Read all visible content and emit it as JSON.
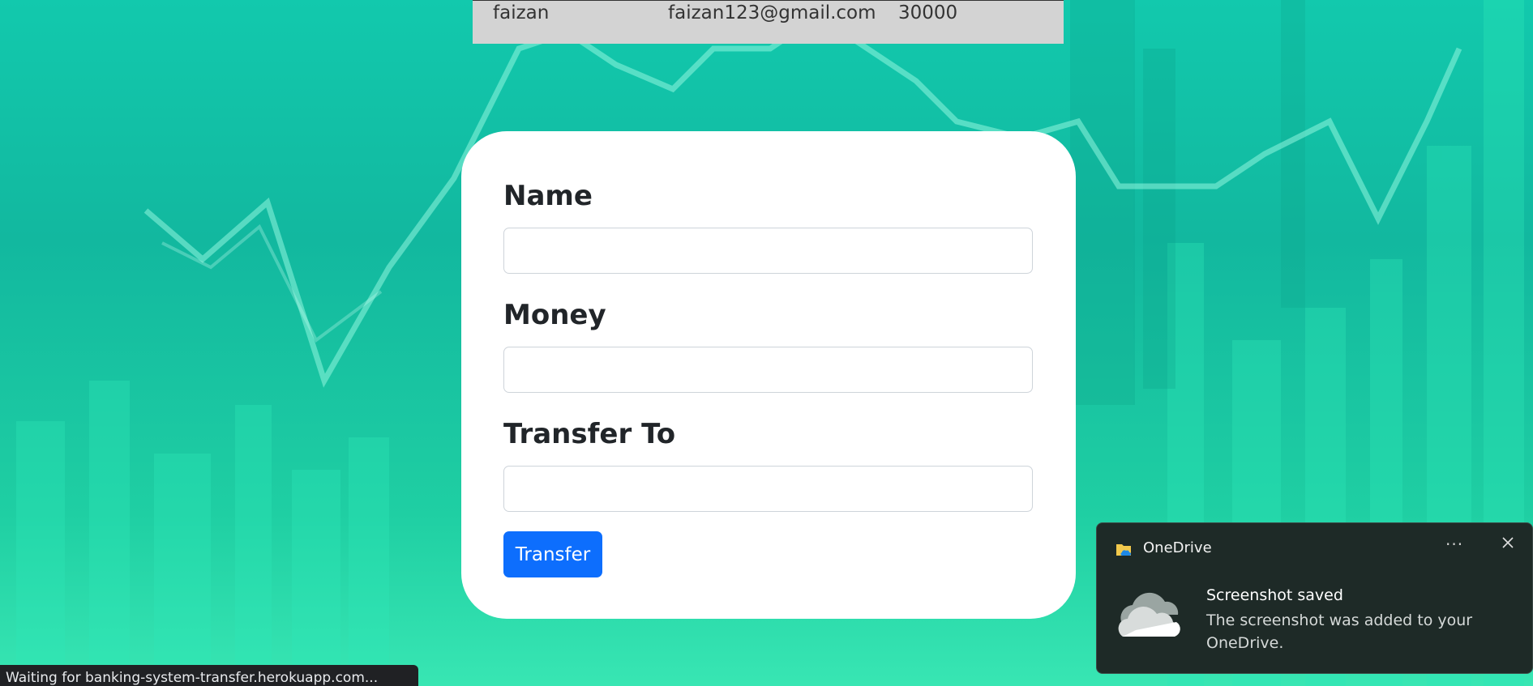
{
  "table_row": {
    "name": "faizan",
    "email": "faizan123@gmail.com",
    "balance": "30000"
  },
  "form": {
    "name_label": "Name",
    "name_value": "",
    "money_label": "Money",
    "money_value": "",
    "transfer_to_label": "Transfer To",
    "transfer_to_value": "",
    "submit_label": "Transfer"
  },
  "status_bar": {
    "text": "Waiting for banking-system-transfer.herokuapp.com..."
  },
  "notification": {
    "app_name": "OneDrive",
    "more_icon": "ellipsis-icon",
    "close_icon": "close-icon",
    "title": "Screenshot saved",
    "body": "The screenshot was added to your OneDrive."
  },
  "colors": {
    "background": "#12c9ad",
    "primary_button": "#0d6efd",
    "card": "#ffffff",
    "toast": "#1e2a27"
  }
}
